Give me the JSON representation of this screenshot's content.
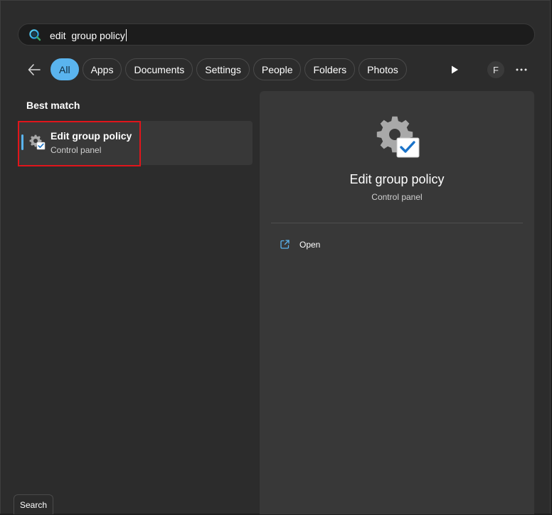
{
  "search": {
    "value": "edit  group policy"
  },
  "filters": [
    {
      "label": "All",
      "active": true
    },
    {
      "label": "Apps",
      "active": false
    },
    {
      "label": "Documents",
      "active": false
    },
    {
      "label": "Settings",
      "active": false
    },
    {
      "label": "People",
      "active": false
    },
    {
      "label": "Folders",
      "active": false
    },
    {
      "label": "Photos",
      "active": false
    }
  ],
  "profile": {
    "initial": "F"
  },
  "results": {
    "section_title": "Best match",
    "best_match": {
      "title": "Edit group policy",
      "subtitle": "Control panel",
      "icon": "gear-checkbox-icon"
    }
  },
  "preview": {
    "title": "Edit group policy",
    "subtitle": "Control panel",
    "icon": "gear-checkbox-icon",
    "actions": [
      {
        "label": "Open",
        "icon": "open-external-icon"
      }
    ]
  },
  "tooltip": {
    "text": "Search"
  },
  "colors": {
    "accent": "#5ab4ee",
    "highlight_border": "#e0151b",
    "background": "#2c2c2c",
    "panel": "#383838"
  }
}
